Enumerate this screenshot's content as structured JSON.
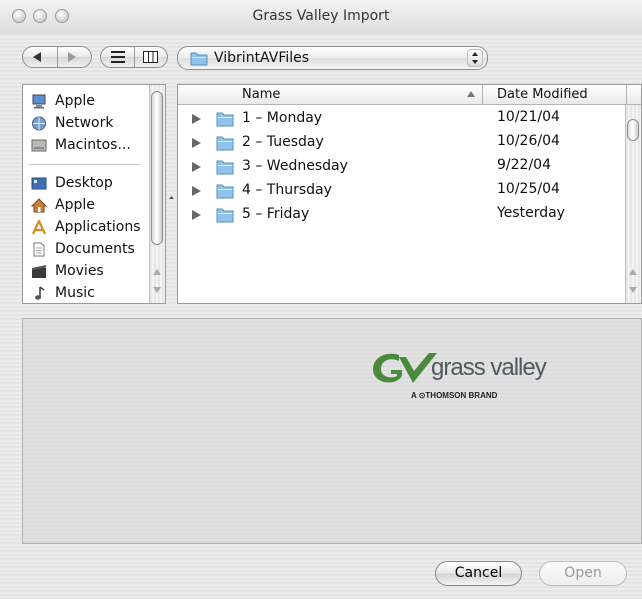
{
  "window": {
    "title": "Grass Valley Import"
  },
  "toolbar": {
    "back_icon": "chevron-left-icon",
    "forward_icon": "chevron-right-icon",
    "list_view_icon": "list-view-icon",
    "column_view_icon": "column-view-icon",
    "location": "VibrintAVFiles"
  },
  "sidebar": {
    "items": [
      {
        "label": "Apple",
        "icon": "computer-icon"
      },
      {
        "label": "Network",
        "icon": "network-globe-icon"
      },
      {
        "label": "Macintos...",
        "icon": "hard-drive-icon"
      },
      {
        "label": "Desktop",
        "icon": "desktop-icon"
      },
      {
        "label": "Apple",
        "icon": "home-icon"
      },
      {
        "label": "Applications",
        "icon": "applications-icon"
      },
      {
        "label": "Documents",
        "icon": "documents-icon"
      },
      {
        "label": "Movies",
        "icon": "movies-icon"
      },
      {
        "label": "Music",
        "icon": "music-note-icon"
      }
    ]
  },
  "file_list": {
    "columns": {
      "name": "Name",
      "date": "Date Modified"
    },
    "rows": [
      {
        "name": "1 – Monday",
        "date": "10/21/04"
      },
      {
        "name": "2 – Tuesday",
        "date": "10/26/04"
      },
      {
        "name": "3 – Wednesday",
        "date": "9/22/04"
      },
      {
        "name": "4 – Thursday",
        "date": "10/25/04"
      },
      {
        "name": "5 – Friday",
        "date": "Yesterday"
      }
    ]
  },
  "preview": {
    "logo_text": "grass valley",
    "logo_tagline": "A ⊙THOMSON BRAND"
  },
  "buttons": {
    "cancel": "Cancel",
    "open": "Open"
  },
  "colors": {
    "folder": "#8fc3ea",
    "logo_green": "#4a8a3c",
    "logo_gray": "#4d5b5e"
  }
}
